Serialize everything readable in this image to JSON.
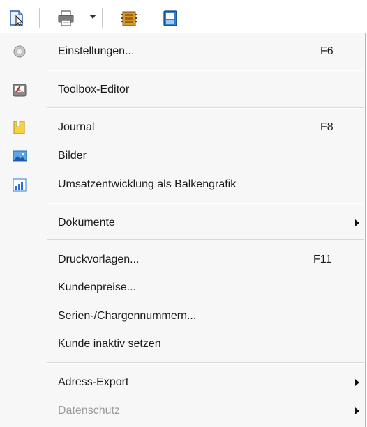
{
  "toolbar": {
    "icons": [
      "document-cursor-icon",
      "printer-icon",
      "dropdown-arrow-icon",
      "ledger-icon",
      "window-icon"
    ]
  },
  "menu": {
    "items": [
      {
        "label": "Einstellungen...",
        "shortcut": "F6",
        "icon": "settings-disc-icon"
      },
      {
        "label": "Toolbox-Editor",
        "shortcut": "",
        "icon": "toolbox-icon"
      },
      {
        "label": "Journal",
        "shortcut": "F8",
        "icon": "journal-note-icon"
      },
      {
        "label": "Bilder",
        "shortcut": "",
        "icon": "pictures-icon"
      },
      {
        "label": "Umsatzentwicklung als Balkengrafik",
        "shortcut": "",
        "icon": "bar-chart-icon"
      },
      {
        "label": "Dokumente",
        "shortcut": "",
        "submenu": true
      },
      {
        "label": "Druckvorlagen...",
        "shortcut": "F11"
      },
      {
        "label": "Kundenpreise...",
        "shortcut": ""
      },
      {
        "label": "Serien-/Chargennummern...",
        "shortcut": ""
      },
      {
        "label": "Kunde inaktiv setzen",
        "shortcut": ""
      },
      {
        "label": "Adress-Export",
        "shortcut": "",
        "submenu": true
      },
      {
        "label": "Datenschutz",
        "shortcut": "",
        "submenu": true,
        "disabled": true
      }
    ]
  },
  "colors": {
    "menu_background": "#f7f7f7",
    "text": "#1a1a1a",
    "disabled_text": "#9b9b9b",
    "separator": "#d9d9d9"
  }
}
